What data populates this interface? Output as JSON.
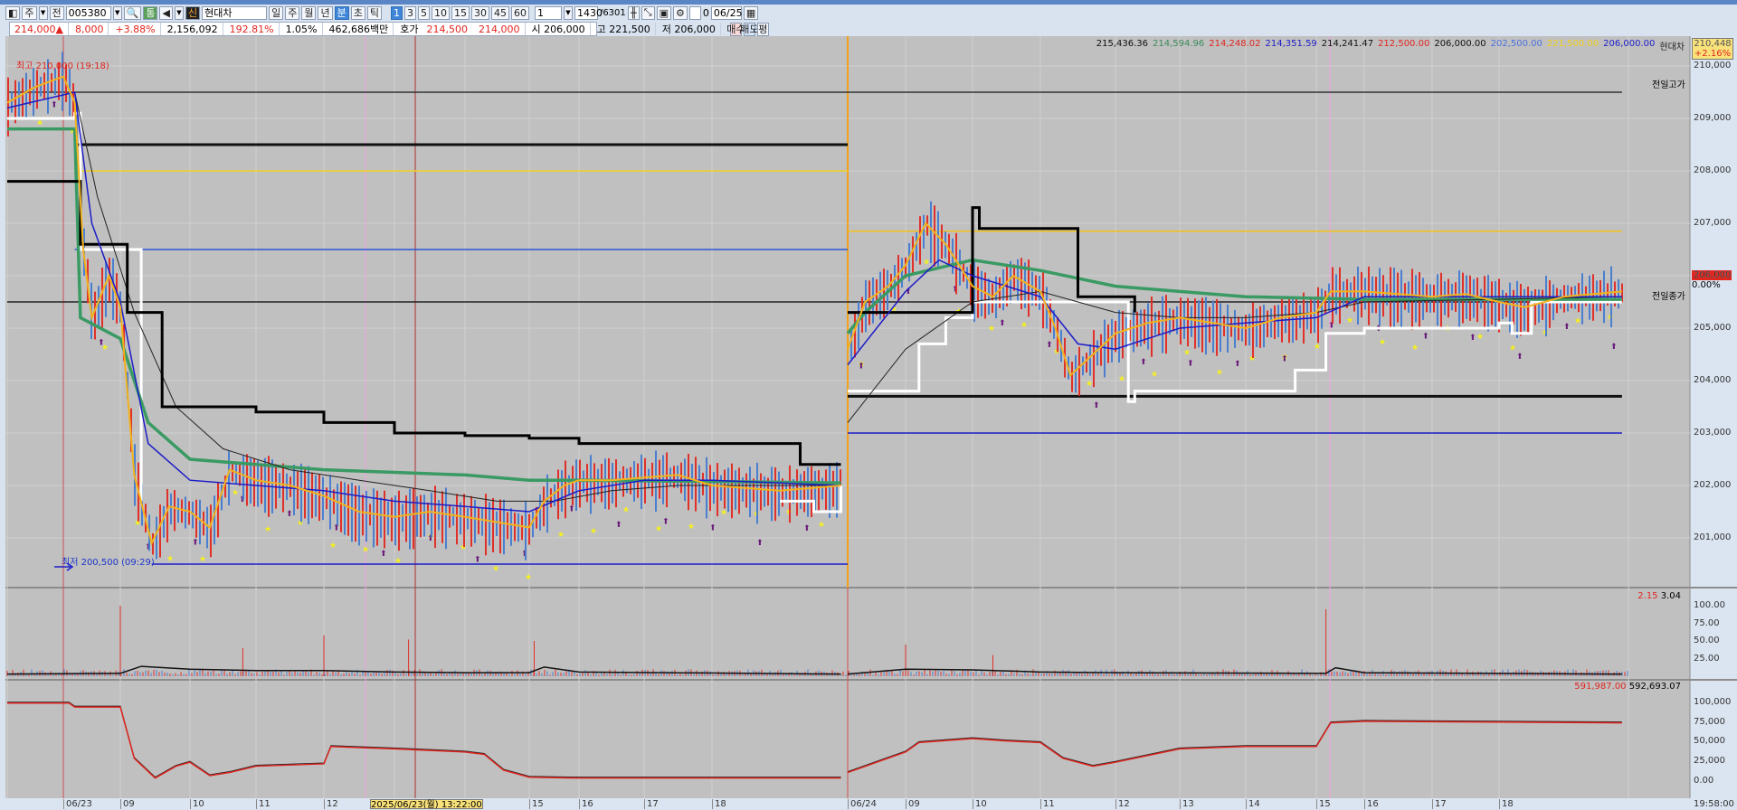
{
  "toolbar": {
    "market": "주",
    "prefix": "전",
    "code": "005380",
    "tong": "통",
    "sin": "신",
    "name": "현대차",
    "periods": [
      "일",
      "주",
      "월",
      "년",
      "분",
      "초",
      "틱"
    ],
    "active_period": "분",
    "intervals": [
      "1",
      "3",
      "5",
      "10",
      "15",
      "30",
      "45",
      "60"
    ],
    "active_interval": "1",
    "unit_select": "1",
    "count": "1430",
    "total": "/6301",
    "checkbox_label": "0",
    "date": "06/25"
  },
  "quote": {
    "price": "214,000▲",
    "change": "8,000",
    "change_pct": "+3.88%",
    "volume": "2,156,092",
    "vol_ratio": "192.81%",
    "turnover": "1.05%",
    "amount": "462,686백만",
    "hoga_label": "호가",
    "ask": "214,500",
    "bid": "214,000",
    "open": "시 206,000",
    "high": "고 221,500",
    "low": "저 206,000",
    "buy": "매수",
    "sell": "매도",
    "avg": "평"
  },
  "legend": [
    {
      "text": "215,436.36",
      "color": "#111111"
    },
    {
      "text": "214,594.96",
      "color": "#3a8a5a"
    },
    {
      "text": "214,248.02",
      "color": "#e0251f"
    },
    {
      "text": "214,351.59",
      "color": "#1c1cc8"
    },
    {
      "text": "214,241.47",
      "color": "#111111"
    },
    {
      "text": "212,500.00",
      "color": "#e0251f"
    },
    {
      "text": "206,000.00",
      "color": "#111111"
    },
    {
      "text": "202,500.00",
      "color": "#4a70e0"
    },
    {
      "text": "221,500.00",
      "color": "#f2d21c"
    },
    {
      "text": "206,000.00",
      "color": "#1c1cc8"
    },
    {
      "text": "현대차",
      "color": "#222222"
    }
  ],
  "current_box": {
    "price": "210,448",
    "pct": "+2.16%"
  },
  "last_badge": {
    "price": "206,000",
    "pct": "0.00%"
  },
  "annotations": {
    "high": "최고 210,000 (19:18)",
    "low": "최저 200,500 (09:29)",
    "prev_high": "전일고가",
    "prev_close": "전일종가"
  },
  "volume_legend": {
    "a": "2.15",
    "b": "3.04"
  },
  "osc_legend": {
    "a": "591,987.00",
    "b": "592,693.07"
  },
  "price_axis": [
    "210,000",
    "209,000",
    "208,000",
    "207,000",
    "206,000",
    "205,000",
    "204,000",
    "203,000",
    "202,000",
    "201,000"
  ],
  "volume_axis": [
    "100.00",
    "75.00",
    "50.00",
    "25.00"
  ],
  "osc_axis": [
    "100,000",
    "75,000",
    "50,000",
    "25,000",
    "0.00"
  ],
  "time_axis": [
    "06/23",
    "09",
    "10",
    "11",
    "12",
    "14",
    "15",
    "16",
    "17",
    "18",
    "06/24",
    "09",
    "10",
    "11",
    "12",
    "13",
    "14",
    "15",
    "16",
    "17",
    "18"
  ],
  "crosshair_time": "2025/06/23(월) 13:22:00",
  "last_time": "19:58:00",
  "chart_data": {
    "type": "line",
    "x_unit": "hours (06/24 = +24)",
    "price_ylim": [
      200000,
      210500
    ],
    "close": [
      [
        7.0,
        209300
      ],
      [
        7.5,
        209600
      ],
      [
        8.0,
        209800
      ],
      [
        8.2,
        209300
      ],
      [
        8.35,
        206500
      ],
      [
        8.5,
        205200
      ],
      [
        8.8,
        206000
      ],
      [
        9.0,
        205400
      ],
      [
        9.2,
        202200
      ],
      [
        9.45,
        200900
      ],
      [
        9.7,
        201600
      ],
      [
        10,
        201500
      ],
      [
        10.3,
        201200
      ],
      [
        10.6,
        202300
      ],
      [
        11,
        202100
      ],
      [
        11.5,
        202000
      ],
      [
        12,
        201800
      ],
      [
        12.5,
        201500
      ],
      [
        13,
        201400
      ],
      [
        13.5,
        201500
      ],
      [
        14,
        201400
      ],
      [
        14.5,
        201300
      ],
      [
        15,
        201200
      ],
      [
        15.3,
        201700
      ],
      [
        15.7,
        202000
      ],
      [
        16,
        202100
      ],
      [
        16.5,
        202100
      ],
      [
        17,
        202150
      ],
      [
        17.5,
        202200
      ],
      [
        18,
        202000
      ],
      [
        19,
        201900
      ],
      [
        19.9,
        202000
      ],
      [
        32.0,
        204600
      ],
      [
        32.3,
        205500
      ],
      [
        32.7,
        205800
      ],
      [
        33,
        206200
      ],
      [
        33.3,
        207000
      ],
      [
        33.6,
        206600
      ],
      [
        34,
        205800
      ],
      [
        34.3,
        205600
      ],
      [
        34.6,
        206000
      ],
      [
        35,
        205700
      ],
      [
        35.2,
        205000
      ],
      [
        35.4,
        204100
      ],
      [
        35.7,
        204500
      ],
      [
        36,
        204900
      ],
      [
        36.5,
        205100
      ],
      [
        37,
        205200
      ],
      [
        37.5,
        205100
      ],
      [
        38,
        205000
      ],
      [
        38.5,
        205200
      ],
      [
        39,
        205300
      ],
      [
        39.3,
        205700
      ],
      [
        40,
        205700
      ],
      [
        40.5,
        205650
      ],
      [
        41,
        205600
      ],
      [
        41.5,
        205650
      ],
      [
        42,
        205500
      ],
      [
        42.4,
        205400
      ],
      [
        43,
        205600
      ],
      [
        43.9,
        205700
      ]
    ],
    "ma_fast": [
      [
        7.0,
        209200
      ],
      [
        8.2,
        209500
      ],
      [
        8.5,
        207000
      ],
      [
        9.0,
        205500
      ],
      [
        9.4,
        202800
      ],
      [
        10,
        202100
      ],
      [
        11,
        202000
      ],
      [
        12,
        201900
      ],
      [
        13,
        201700
      ],
      [
        14,
        201600
      ],
      [
        15,
        201500
      ],
      [
        16,
        201900
      ],
      [
        17,
        202100
      ],
      [
        18,
        202100
      ],
      [
        19.9,
        202000
      ],
      [
        32,
        204300
      ],
      [
        33,
        205700
      ],
      [
        33.5,
        206300
      ],
      [
        34,
        206000
      ],
      [
        35,
        205600
      ],
      [
        35.5,
        204700
      ],
      [
        36,
        204600
      ],
      [
        37,
        205000
      ],
      [
        38,
        205100
      ],
      [
        39,
        205200
      ],
      [
        40,
        205600
      ],
      [
        42,
        205600
      ],
      [
        43.9,
        205600
      ]
    ],
    "ma_slow": [
      [
        8.2,
        209500
      ],
      [
        8.6,
        207500
      ],
      [
        9.2,
        205300
      ],
      [
        9.8,
        203500
      ],
      [
        10.5,
        202700
      ],
      [
        11.5,
        202300
      ],
      [
        12.5,
        202100
      ],
      [
        13.5,
        201900
      ],
      [
        14.5,
        201700
      ],
      [
        15.5,
        201700
      ],
      [
        16.5,
        201900
      ],
      [
        17.5,
        202000
      ],
      [
        19.9,
        202000
      ],
      [
        32,
        203200
      ],
      [
        33,
        204600
      ],
      [
        34,
        205500
      ],
      [
        35,
        205700
      ],
      [
        36,
        205300
      ],
      [
        37,
        205200
      ],
      [
        38,
        205200
      ],
      [
        39,
        205300
      ],
      [
        40,
        205500
      ],
      [
        43.9,
        205600
      ]
    ],
    "ma_green": [
      [
        7.0,
        208800
      ],
      [
        8.2,
        208800
      ],
      [
        8.3,
        205200
      ],
      [
        9.0,
        204800
      ],
      [
        9.4,
        203200
      ],
      [
        10,
        202500
      ],
      [
        11,
        202400
      ],
      [
        12,
        202300
      ],
      [
        13,
        202250
      ],
      [
        14,
        202200
      ],
      [
        15,
        202100
      ],
      [
        16,
        202100
      ],
      [
        19.9,
        202050
      ],
      [
        32,
        204900
      ],
      [
        32.3,
        205300
      ],
      [
        33,
        206000
      ],
      [
        34,
        206300
      ],
      [
        35,
        206100
      ],
      [
        36,
        205800
      ],
      [
        37,
        205700
      ],
      [
        38,
        205600
      ],
      [
        40,
        205550
      ],
      [
        43.9,
        205550
      ]
    ],
    "step_black": [
      [
        7.0,
        207800
      ],
      [
        8.2,
        207800
      ],
      [
        8.3,
        206600
      ],
      [
        9.0,
        206600
      ],
      [
        9.1,
        205300
      ],
      [
        9.3,
        205300
      ],
      [
        9.6,
        203500
      ],
      [
        11,
        203400
      ],
      [
        12,
        203200
      ],
      [
        13,
        203000
      ],
      [
        14,
        202950
      ],
      [
        15,
        202900
      ],
      [
        16,
        202800
      ],
      [
        18,
        202800
      ],
      [
        19.2,
        202800
      ],
      [
        19.3,
        202400
      ],
      [
        19.9,
        202400
      ],
      [
        32,
        205300
      ],
      [
        33.5,
        205300
      ],
      [
        34,
        207300
      ],
      [
        34.1,
        206900
      ],
      [
        35.2,
        206900
      ],
      [
        35.5,
        205600
      ],
      [
        36.3,
        205300
      ]
    ],
    "step_white": [
      [
        7.0,
        209000
      ],
      [
        8.2,
        209100
      ],
      [
        8.3,
        206500
      ],
      [
        9.3,
        201700
      ],
      [
        19.0,
        201700
      ],
      [
        19.5,
        201500
      ],
      [
        19.9,
        202000
      ],
      [
        32,
        203800
      ],
      [
        33.2,
        204700
      ],
      [
        33.6,
        205200
      ],
      [
        34,
        205500
      ],
      [
        35.2,
        205500
      ],
      [
        36.2,
        203600
      ],
      [
        36.3,
        203800
      ],
      [
        38.6,
        203800
      ],
      [
        38.7,
        204200
      ],
      [
        39.2,
        204900
      ],
      [
        40,
        205000
      ],
      [
        42,
        205100
      ],
      [
        42.2,
        204900
      ],
      [
        42.5,
        205500
      ],
      [
        43.9,
        205500
      ]
    ],
    "levels": [
      {
        "price": 209500,
        "from": 7.0,
        "to": 43.9,
        "color": "#333333",
        "label": "전일고가"
      },
      {
        "price": 208000,
        "from": 8.2,
        "to": 20,
        "color": "#f2d21c"
      },
      {
        "price": 208500,
        "from": 8.2,
        "to": 20,
        "color": "#111111"
      },
      {
        "price": 206500,
        "from": 8.2,
        "to": 20,
        "color": "#2a55d8"
      },
      {
        "price": 200500,
        "from": 9.45,
        "to": 20,
        "color": "#1c1cc8"
      },
      {
        "price": 206850,
        "from": 32,
        "to": 43.9,
        "color": "#f2c21c"
      },
      {
        "price": 203700,
        "from": 32,
        "to": 43.9,
        "color": "#111111"
      },
      {
        "price": 203000,
        "from": 32,
        "to": 43.9,
        "color": "#1c1cc8"
      },
      {
        "price": 205500,
        "from": 7.0,
        "to": 43.9,
        "color": "#222222",
        "label": "전일종가"
      }
    ],
    "volume_ylim": [
      0,
      110
    ],
    "volume_spikes": [
      [
        9.0,
        100
      ],
      [
        10.8,
        40
      ],
      [
        12.0,
        58
      ],
      [
        13.2,
        52
      ],
      [
        15.1,
        50
      ],
      [
        33.0,
        45
      ],
      [
        34.3,
        30
      ],
      [
        39.2,
        95
      ]
    ],
    "volume_ma": [
      [
        7,
        3
      ],
      [
        9.0,
        4
      ],
      [
        9.3,
        14
      ],
      [
        10,
        10
      ],
      [
        11,
        8
      ],
      [
        12,
        8
      ],
      [
        13,
        6
      ],
      [
        14,
        5
      ],
      [
        15,
        5
      ],
      [
        15.3,
        13
      ],
      [
        16,
        6
      ],
      [
        19.9,
        3
      ],
      [
        32,
        3
      ],
      [
        33,
        10
      ],
      [
        34,
        9
      ],
      [
        35,
        6
      ],
      [
        36,
        5
      ],
      [
        39.2,
        4
      ],
      [
        39.4,
        12
      ],
      [
        40,
        5
      ],
      [
        43.9,
        3
      ]
    ],
    "osc_ylim": [
      0,
      110000
    ],
    "osc": [
      [
        7,
        100000
      ],
      [
        8.1,
        100000
      ],
      [
        8.2,
        95000
      ],
      [
        9.0,
        95000
      ],
      [
        9.2,
        30000
      ],
      [
        9.5,
        5000
      ],
      [
        9.8,
        20000
      ],
      [
        10,
        25000
      ],
      [
        10.3,
        8000
      ],
      [
        10.6,
        12000
      ],
      [
        11,
        20000
      ],
      [
        12,
        23000
      ],
      [
        12.1,
        45000
      ],
      [
        13,
        42000
      ],
      [
        14,
        38000
      ],
      [
        14.3,
        35000
      ],
      [
        14.6,
        15000
      ],
      [
        15,
        6000
      ],
      [
        16,
        5000
      ],
      [
        19.9,
        5000
      ],
      [
        32,
        12000
      ],
      [
        33,
        38000
      ],
      [
        33.2,
        50000
      ],
      [
        34,
        55000
      ],
      [
        34.5,
        52000
      ],
      [
        35,
        50000
      ],
      [
        35.3,
        30000
      ],
      [
        35.7,
        20000
      ],
      [
        36,
        25000
      ],
      [
        37,
        42000
      ],
      [
        38,
        45000
      ],
      [
        39,
        45000
      ],
      [
        39.3,
        75000
      ],
      [
        40,
        77000
      ],
      [
        43.9,
        75000
      ]
    ]
  }
}
